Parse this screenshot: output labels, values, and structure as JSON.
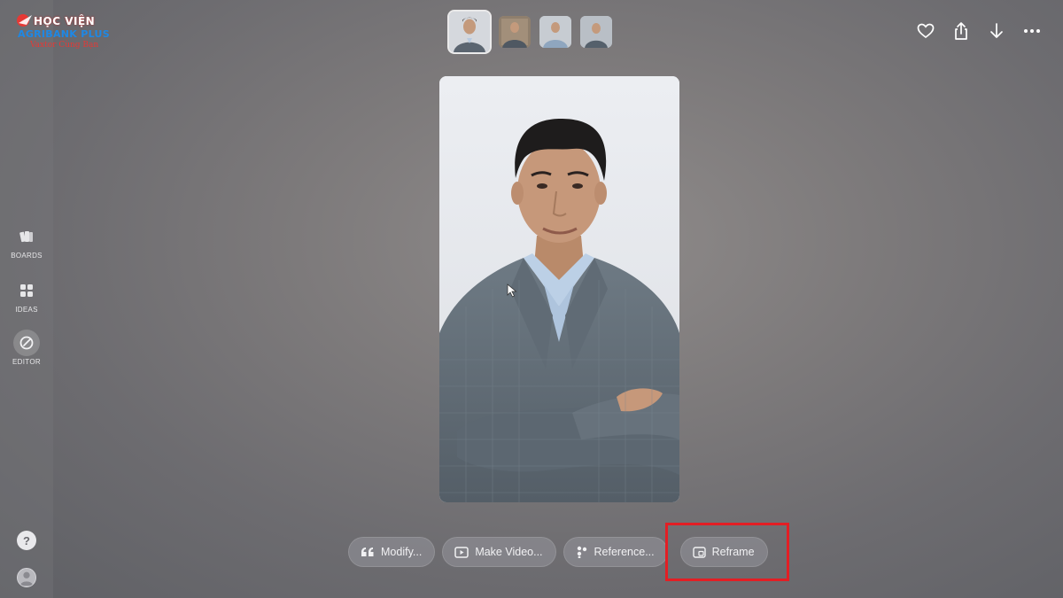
{
  "logo": {
    "line1": "HỌC VIỆN",
    "line2": "AGRIBANK PLUS",
    "line3": "Vaxtor Cùng Bạn"
  },
  "sidebar": {
    "items": [
      {
        "label": "BOARDS",
        "icon": "boards-icon"
      },
      {
        "label": "IDEAS",
        "icon": "ideas-icon"
      },
      {
        "label": "EDITOR",
        "icon": "editor-icon",
        "active": true
      }
    ],
    "help_label": "?"
  },
  "thumbnails": [
    {
      "selected": true
    },
    {
      "selected": false
    },
    {
      "selected": false
    },
    {
      "selected": false
    }
  ],
  "top_actions": [
    "heart-icon",
    "share-icon",
    "download-icon",
    "more-icon"
  ],
  "toolbar": {
    "modify_label": "Modify...",
    "make_video_label": "Make Video...",
    "reference_label": "Reference...",
    "reframe_label": "Reframe"
  },
  "colors": {
    "highlight": "#e31e24"
  }
}
